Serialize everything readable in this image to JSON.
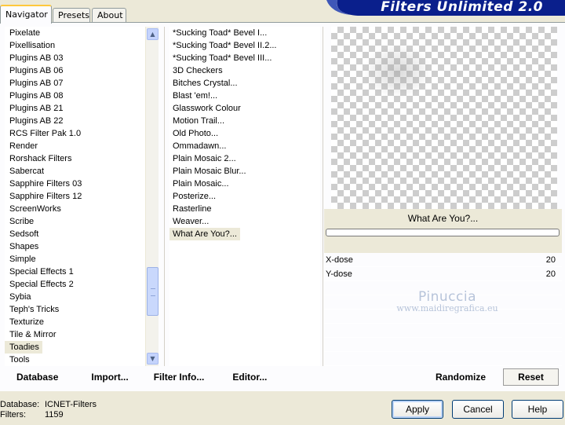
{
  "tabs": [
    {
      "label": "Navigator"
    },
    {
      "label": "Presets"
    },
    {
      "label": "About"
    }
  ],
  "app_title": "Filters Unlimited 2.0",
  "categories": [
    "Pixelate",
    "Pixellisation",
    "Plugins AB 03",
    "Plugins AB 06",
    "Plugins AB 07",
    "Plugins AB 08",
    "Plugins AB 21",
    "Plugins AB 22",
    "RCS Filter Pak 1.0",
    "Render",
    "Rorshack Filters",
    "Sabercat",
    "Sapphire Filters 03",
    "Sapphire Filters 12",
    "ScreenWorks",
    "Scribe",
    "Sedsoft",
    "Shapes",
    "Simple",
    "Special Effects 1",
    "Special Effects 2",
    "Sybia",
    "Teph's Tricks",
    "Texturize",
    "Tile & Mirror",
    "Toadies",
    "Tools"
  ],
  "selected_category": "Toadies",
  "filters": [
    "*Sucking Toad*  Bevel I...",
    "*Sucking Toad*  Bevel II.2...",
    "*Sucking Toad*  Bevel III...",
    "3D Checkers",
    "Bitches Crystal...",
    "Blast 'em!...",
    "Glasswork Colour",
    "Motion Trail...",
    "Old Photo...",
    "Ommadawn...",
    "Plain Mosaic 2...",
    "Plain Mosaic Blur...",
    "Plain Mosaic...",
    "Posterize...",
    "Rasterline",
    "Weaver...",
    "What Are You?..."
  ],
  "selected_filter": "What Are You?...",
  "filter_name": "What Are You?...",
  "params": [
    {
      "label": "X-dose",
      "value": "20"
    },
    {
      "label": "Y-dose",
      "value": "20"
    }
  ],
  "watermark": {
    "name": "Pinuccia",
    "url": "www.maidiregrafica.eu"
  },
  "strip": {
    "database": "Database",
    "import": "Import...",
    "filter_info": "Filter Info...",
    "editor": "Editor...",
    "randomize": "Randomize",
    "reset": "Reset"
  },
  "status": {
    "database_label": "Database:",
    "database_value": "ICNET-Filters",
    "filters_label": "Filters:",
    "filters_value": "1159"
  },
  "buttons": {
    "apply": "Apply",
    "cancel": "Cancel",
    "help": "Help"
  },
  "colors": {
    "banner": "#0a1f8c",
    "selected_tab_accent": "#ffc83c"
  }
}
